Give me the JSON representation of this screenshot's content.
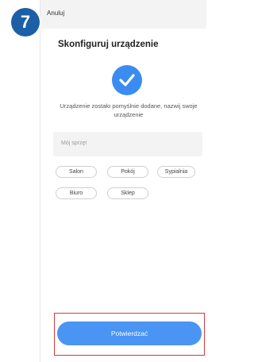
{
  "step_badge": "7",
  "header": {
    "cancel_label": "Anuluj"
  },
  "main": {
    "title": "Skonfiguruj urządzenie",
    "success_message": "Urządzenie zostało pomyślnie dodane, nazwij swoje urządzenie",
    "name_input": {
      "placeholder": "Mój sprzęt",
      "value": ""
    },
    "room_chips": [
      "Salon",
      "Pokój",
      "Sypialnia",
      "Biuro",
      "Sklep"
    ]
  },
  "footer": {
    "confirm_label": "Potwierdzać"
  },
  "colors": {
    "accent": "#4a94f3",
    "highlight": "#d23b3b",
    "badge": "#1d5fa6"
  }
}
